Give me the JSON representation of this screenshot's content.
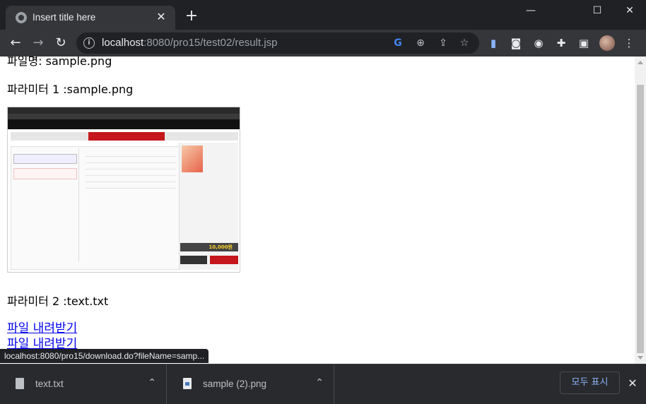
{
  "browser": {
    "tab_title": "Insert title here",
    "tab_close": "✕",
    "new_tab": "+",
    "window_controls": {
      "minimize": "—",
      "maximize": "☐",
      "close": "✕"
    },
    "url_host": "localhost",
    "url_rest": ":8080/pro15/test02/result.jsp",
    "icons": [
      "back-icon",
      "forward-icon",
      "reload-icon",
      "site-info-icon",
      "google-icon",
      "zoom-icon",
      "share-icon",
      "bookmark-star-icon",
      "extension-icon",
      "profile-avatar",
      "menu-icon"
    ]
  },
  "page": {
    "line_filename_cut": "파일명: sample.png",
    "param1": "파라미터 1 :sample.png",
    "param2": "파라미터 2 :text.txt",
    "download_link_1": "파일 내려받기",
    "download_link_2": "파일 내려받기"
  },
  "embedded_image": {
    "alt": "sample.png",
    "total_price": "10,000원"
  },
  "status_bar": {
    "url": "localhost:8080/pro15/download.do?fileName=samp..."
  },
  "download_shelf": {
    "items": [
      {
        "name": "text.txt",
        "chevron": "⌃"
      },
      {
        "name": "sample (2).png",
        "chevron": "⌃"
      }
    ],
    "show_all": "모두 표시",
    "close": "✕"
  }
}
